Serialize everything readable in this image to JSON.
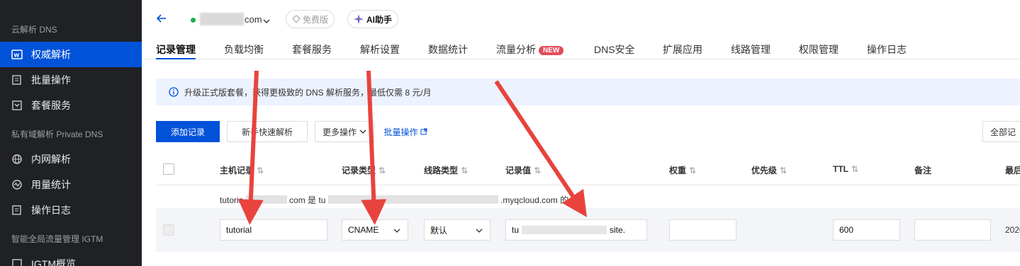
{
  "sidebar": {
    "section_dns": "云解析 DNS",
    "items_dns": [
      {
        "label": "权威解析",
        "active": true
      },
      {
        "label": "批量操作"
      },
      {
        "label": "套餐服务"
      }
    ],
    "section_private": "私有域解析 Private DNS",
    "items_private": [
      {
        "label": "内网解析"
      },
      {
        "label": "用量统计"
      },
      {
        "label": "操作日志"
      }
    ],
    "section_igtm": "智能全局流量管理 IGTM",
    "items_igtm": [
      {
        "label": "IGTM概览"
      }
    ]
  },
  "header": {
    "domain_suffix": "com",
    "free_badge": "免费版",
    "ai_badge": "AI助手"
  },
  "tabs": [
    {
      "label": "记录管理",
      "active": true
    },
    {
      "label": "负载均衡"
    },
    {
      "label": "套餐服务"
    },
    {
      "label": "解析设置"
    },
    {
      "label": "数据统计"
    },
    {
      "label": "流量分析",
      "badge": "NEW"
    },
    {
      "label": "DNS安全"
    },
    {
      "label": "扩展应用"
    },
    {
      "label": "线路管理"
    },
    {
      "label": "权限管理"
    },
    {
      "label": "操作日志"
    }
  ],
  "notice": {
    "text": "升级正式版套餐，获得更极致的 DNS 解析服务，最低仅需 8 元/月"
  },
  "toolbar": {
    "add_record": "添加记录",
    "quick_parse": "新手快速解析",
    "more_ops": "更多操作",
    "batch_ops": "批量操作",
    "all_records": "全部记"
  },
  "table": {
    "headers": [
      "主机记录",
      "记录类型",
      "线路类型",
      "记录值",
      "权重",
      "优先级",
      "TTL",
      "备注",
      "最后"
    ],
    "hint": "tutoria... com 是 tu... myqcloud.com 的别",
    "hint_left": "tutoria",
    "hint_mid": "com  是  tu",
    "hint_right": ".myqcloud.com 的",
    "row": {
      "host": "tutorial",
      "type": "CNAME",
      "line": "默认",
      "value_prefix": "tu",
      "value_suffix": "site.",
      "ttl": "600",
      "date": "2020"
    }
  },
  "colors": {
    "accent": "#0052d9",
    "sidebar_bg": "#1f2124",
    "arrow": "#e8433d",
    "new_badge": "#e34d59"
  }
}
